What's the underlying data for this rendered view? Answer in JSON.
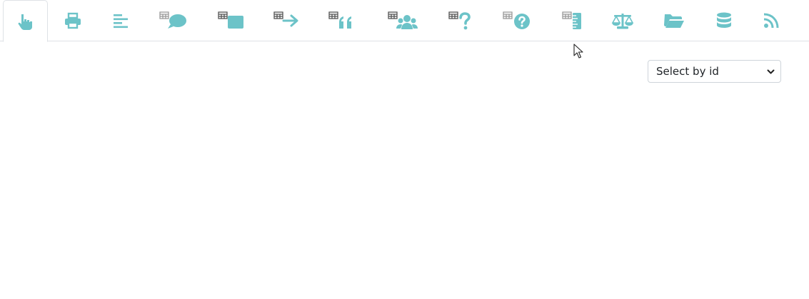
{
  "colors": {
    "accent": "#6cc3c8",
    "table_grid": "#8c8c8c",
    "border": "#dee2e6"
  },
  "tabs": [
    {
      "icon": "hand-pointer-icon",
      "active": true
    },
    {
      "icon": "print-icon",
      "active": false
    },
    {
      "icon": "align-left-icon",
      "active": false
    },
    {
      "icon": "table-comment-icon",
      "active": false
    },
    {
      "icon": "table-square-icon",
      "active": false
    },
    {
      "icon": "table-arrow-right-icon",
      "active": false
    },
    {
      "icon": "table-quote-icon",
      "active": false
    },
    {
      "icon": "table-users-icon",
      "active": false
    },
    {
      "icon": "table-question-icon",
      "active": false
    },
    {
      "icon": "table-question-circle-icon",
      "active": false
    },
    {
      "icon": "table-ruler-icon",
      "active": false
    },
    {
      "icon": "balance-scale-icon",
      "active": false
    },
    {
      "icon": "folder-open-icon",
      "active": false
    },
    {
      "icon": "database-icon",
      "active": false
    },
    {
      "icon": "rss-icon",
      "active": false
    }
  ],
  "select": {
    "selected_label": "Select by id"
  }
}
